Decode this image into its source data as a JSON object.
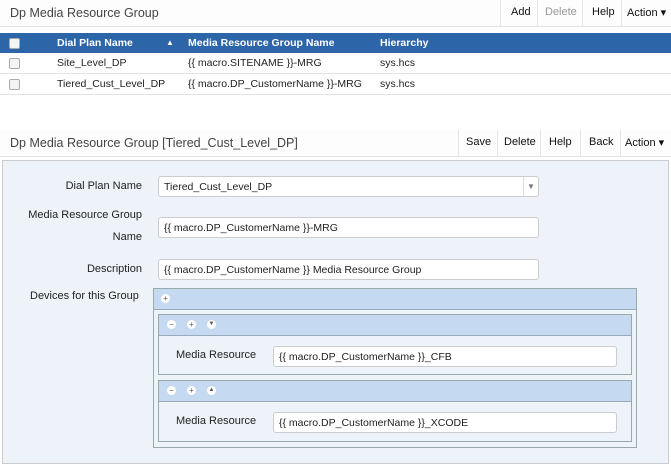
{
  "list": {
    "title": "Dp Media Resource Group",
    "toolbar": {
      "add": "Add",
      "delete": "Delete",
      "help": "Help",
      "action": "Action ▾"
    },
    "columns": [
      "Dial Plan Name",
      "Media Resource Group Name",
      "Hierarchy"
    ],
    "rows": [
      [
        "Site_Level_DP",
        "{{ macro.SITENAME }}-MRG",
        "sys.hcs"
      ],
      [
        "Tiered_Cust_Level_DP",
        "{{ macro.DP_CustomerName }}-MRG",
        "sys.hcs"
      ]
    ]
  },
  "form": {
    "title": "Dp Media Resource Group [Tiered_Cust_Level_DP]",
    "toolbar": {
      "save": "Save",
      "delete": "Delete",
      "help": "Help",
      "back": "Back",
      "action": "Action ▾"
    },
    "dial_plan_label": "Dial Plan Name",
    "dial_plan_value": "Tiered_Cust_Level_DP",
    "mrg_label_1": "Media Resource Group",
    "mrg_label_2": "Name",
    "mrg_value": "{{ macro.DP_CustomerName }}-MRG",
    "desc_label": "Description",
    "desc_value": "{{ macro.DP_CustomerName }} Media Resource Group",
    "devices_label": "Devices for this Group",
    "devices": [
      {
        "label": "Media Resource",
        "value": "{{ macro.DP_CustomerName }}_CFB"
      },
      {
        "label": "Media Resource",
        "value": "{{ macro.DP_CustomerName }}_XCODE"
      }
    ]
  },
  "colors": {
    "header_blue": "#2c65a8",
    "group_header": "#c5d9f0",
    "panel_bg": "#eef3f9"
  }
}
